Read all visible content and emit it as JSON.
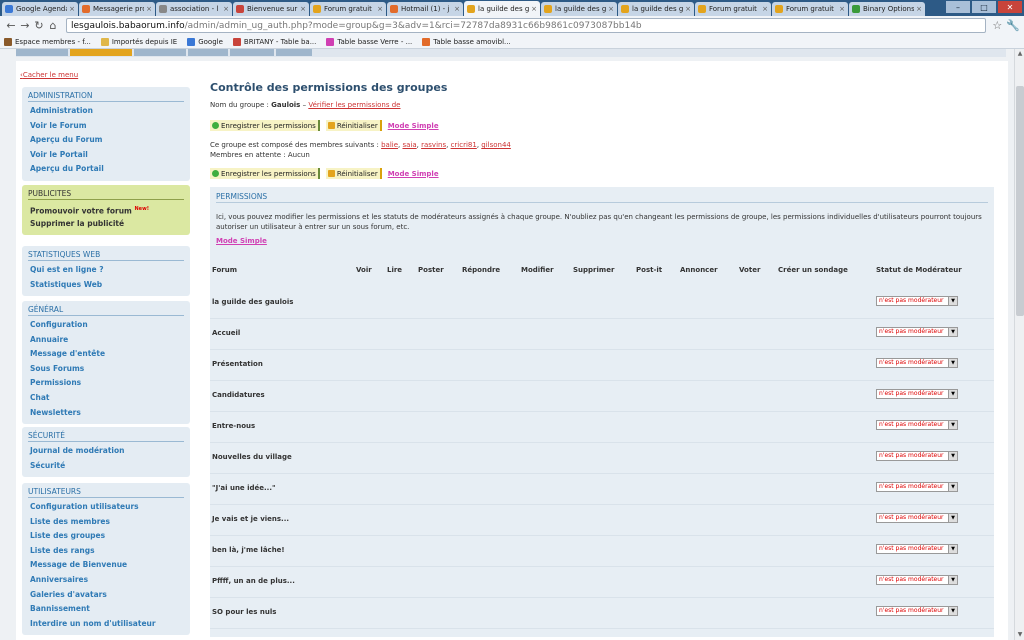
{
  "browser": {
    "tabs": [
      {
        "label": "Google Agenda",
        "color": "#3a78d6"
      },
      {
        "label": "Messagerie pro",
        "color": "#e26b2a"
      },
      {
        "label": "association - l",
        "color": "#888888"
      },
      {
        "label": "Bienvenue sur",
        "color": "#c8443b"
      },
      {
        "label": "Forum gratuit",
        "color": "#e3a41d"
      },
      {
        "label": "Hotmail (1) - j",
        "color": "#e26b2a"
      },
      {
        "label": "la guilde des g",
        "color": "#e3a41d",
        "active": true
      },
      {
        "label": "la guilde des g",
        "color": "#e3a41d"
      },
      {
        "label": "la guilde des g",
        "color": "#e3a41d"
      },
      {
        "label": "Forum gratuit",
        "color": "#e3a41d"
      },
      {
        "label": "Forum gratuit",
        "color": "#e3a41d"
      },
      {
        "label": "Binary Options",
        "color": "#3a9a3a"
      }
    ],
    "url_host": "lesgaulois.babaorum.info",
    "url_path": "/admin/admin_ug_auth.php?mode=group&g=3&adv=1&rci=72787da8931c66b9861c0973087bb14b",
    "bookmarks": [
      {
        "label": "Espace membres - f...",
        "color": "#8a5a2b"
      },
      {
        "label": "Importés depuis IE",
        "color": "#e0b74a"
      },
      {
        "label": "Google",
        "color": "#3a78d6"
      },
      {
        "label": "BRITANY - Table ba...",
        "color": "#c8443b"
      },
      {
        "label": "Table basse Verre - ...",
        "color": "#d03fb3"
      },
      {
        "label": "Table basse amovibl...",
        "color": "#e26b2a"
      }
    ]
  },
  "sidebar": {
    "hide_menu": "Cacher le menu",
    "sections": [
      {
        "title": "ADMINISTRATION",
        "items": [
          "Administration",
          "Voir le Forum",
          "Aperçu du Forum",
          "Voir le Portail",
          "Aperçu du Portail"
        ]
      },
      {
        "title": "PUBLICITES",
        "items": [
          "Promouvoir votre forum",
          "Supprimer la publicité"
        ],
        "new_badge": "New!"
      },
      {
        "title": "STATISTIQUES WEB",
        "items": [
          "Qui est en ligne ?",
          "Statistiques Web"
        ]
      },
      {
        "title": "GÉNÉRAL",
        "items": [
          "Configuration",
          "Annuaire",
          "Message d'entête",
          "Sous Forums",
          "Permissions",
          "Chat",
          "Newsletters"
        ]
      },
      {
        "title": "SÉCURITÉ",
        "items": [
          "Journal de modération",
          "Sécurité"
        ]
      },
      {
        "title": "UTILISATEURS",
        "items": [
          "Configuration utilisateurs",
          "Liste des membres",
          "Liste des groupes",
          "Liste des rangs",
          "Message de Bienvenue",
          "Anniversaires",
          "Galeries d'avatars",
          "Bannissement",
          "Interdire un nom d'utilisateur"
        ]
      }
    ]
  },
  "main": {
    "title": "Contrôle des permissions des groupes",
    "group_label": "Nom du groupe :",
    "group_name": "Gaulois",
    "group_sep": "–",
    "verify_link": "Vérifier les permissions de",
    "save_btn": "Enregistrer les permissions",
    "reset_btn": "Réinitialiser",
    "simple_mode": "Mode Simple",
    "members_label": "Ce groupe est composé des membres suivants :",
    "members": [
      "balie",
      "saia",
      "rasvins",
      "cricri81",
      "gilson44"
    ],
    "pending": "Membres en attente : Aucun",
    "perm_title": "PERMISSIONS",
    "perm_desc": "Ici, vous pouvez modifier les permissions et les statuts de modérateurs assignés à chaque groupe. N'oubliez pas qu'en changeant les permissions de groupe, les permissions individuelles d'utilisateurs pourront toujours autoriser un utilisateur à entrer sur un sous forum, etc.",
    "columns": [
      "Forum",
      "Voir",
      "Lire",
      "Poster",
      "Répondre",
      "Modifier",
      "Supprimer",
      "Post-it",
      "Annoncer",
      "Voter",
      "Créer un sondage",
      "Statut de Modérateur"
    ],
    "moderator_value": "n'est pas modérateur",
    "forums": [
      "la guilde des gaulois",
      "Accueil",
      "Présentation",
      "Candidatures",
      "Entre-nous",
      "Nouvelles du village",
      "\"J'ai une idée...\"",
      "Je vais et je viens...",
      "ben là, j'me lâche!",
      "Pffff, un an de plus...",
      "SO pour les nuls"
    ]
  }
}
